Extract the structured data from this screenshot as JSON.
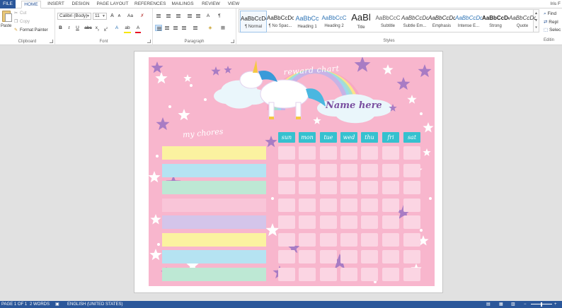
{
  "tabs": [
    "FILE",
    "HOME",
    "INSERT",
    "DESIGN",
    "PAGE LAYOUT",
    "REFERENCES",
    "MAILINGS",
    "REVIEW",
    "VIEW"
  ],
  "active_tab": "HOME",
  "user": "Iris F",
  "clipboard": {
    "paste": "Paste",
    "cut": "Cut",
    "copy": "Copy",
    "format_painter": "Format Painter",
    "label": "Clipboard"
  },
  "font": {
    "name": "Calibri (Body)",
    "size": "11",
    "label": "Font",
    "grow": "A",
    "shrink": "A",
    "change_case": "Aa",
    "bold": "B",
    "italic": "I",
    "underline": "U",
    "strikethrough": "abc",
    "subscript": "x",
    "superscript": "x",
    "text_effects": "A",
    "highlight": "ab",
    "font_color": "A",
    "highlight_color": "#f7e600",
    "font_color_value": "#e81123"
  },
  "paragraph": {
    "label": "Paragraph",
    "sort": "A",
    "show_marks": "¶"
  },
  "styles": {
    "label": "Styles",
    "items": [
      {
        "sample": "AaBbCcDc",
        "name": "¶ Normal",
        "color": "#222222"
      },
      {
        "sample": "AaBbCcDc",
        "name": "¶ No Spac...",
        "color": "#222222"
      },
      {
        "sample": "AaBbCc",
        "name": "Heading 1",
        "color": "#2e74b5"
      },
      {
        "sample": "AaBbCcC",
        "name": "Heading 2",
        "color": "#2e74b5"
      },
      {
        "sample": "AaBl",
        "name": "Title",
        "color": "#222222"
      },
      {
        "sample": "AaBbCcC",
        "name": "Subtitle",
        "color": "#5a5a5a"
      },
      {
        "sample": "AaBbCcDc",
        "name": "Subtle Em...",
        "color": "#404040"
      },
      {
        "sample": "AaBbCcDc",
        "name": "Emphasis",
        "color": "#222222"
      },
      {
        "sample": "AaBbCcDc",
        "name": "Intense E...",
        "color": "#2e74b5"
      },
      {
        "sample": "AaBbCcDc",
        "name": "Strong",
        "color": "#222222"
      },
      {
        "sample": "AaBbCcDc",
        "name": "Quote",
        "color": "#404040"
      }
    ]
  },
  "editing": {
    "find": "Find",
    "replace": "Repl",
    "select": "Selec",
    "label": "Editin"
  },
  "document": {
    "chart_title": "reward chart",
    "name_placeholder": "Name here",
    "chores_heading": "my chores",
    "days": [
      "sun",
      "mon",
      "tue",
      "wed",
      "thu",
      "fri",
      "sat"
    ],
    "rows": 8,
    "stripe_colors": [
      "#fbf2a0",
      "#b5e3f2",
      "#bde8d4",
      "#f9c5d8",
      "#d4c5ea",
      "#fbf2a0",
      "#b5e3f2",
      "#bde8d4"
    ],
    "colors": {
      "background": "#f8b6cd",
      "day_header": "#35c1cf",
      "cell": "#fbd5e3",
      "star_purple": "#a87cc4",
      "star_white": "#ffffff",
      "unicorn_mane": "#3a9ad9",
      "horn": "#f5c842"
    }
  },
  "status": {
    "page": "PAGE 1 OF 1",
    "words": "2 WORDS",
    "language": "ENGLISH (UNITED STATES)"
  }
}
